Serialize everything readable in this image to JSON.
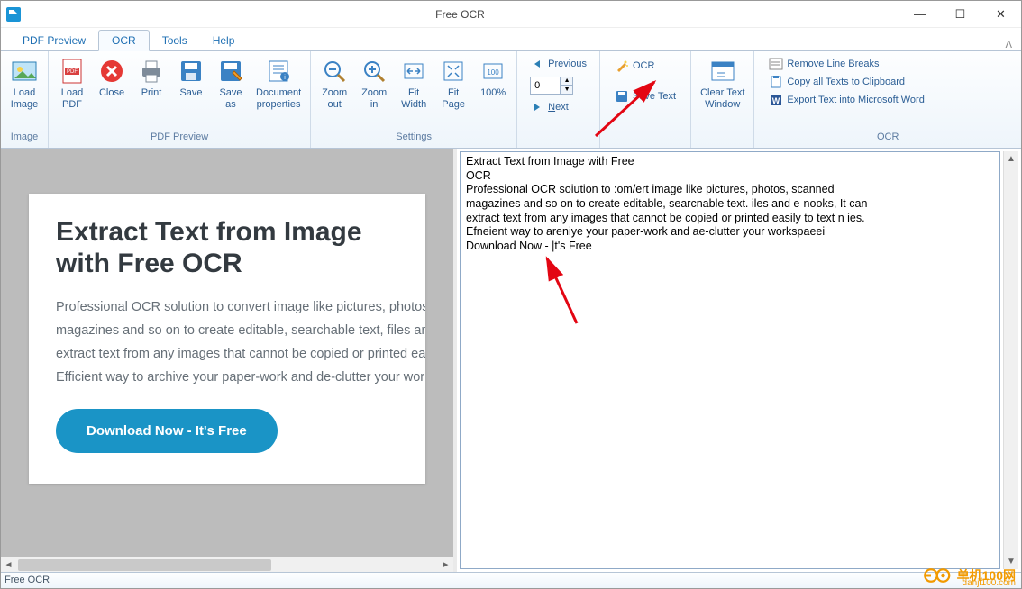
{
  "window": {
    "title": "Free OCR"
  },
  "tabs": {
    "items": [
      {
        "label": "PDF Preview"
      },
      {
        "label": "OCR"
      },
      {
        "label": "Tools"
      },
      {
        "label": "Help"
      }
    ],
    "active_index": 1
  },
  "ribbon": {
    "image": {
      "label": "Image",
      "load_image": "Load\nImage"
    },
    "pdf_preview": {
      "label": "PDF Preview",
      "load_pdf": "Load\nPDF",
      "close": "Close",
      "print": "Print",
      "save": "Save",
      "save_as": "Save\nas",
      "doc_props": "Document\nproperties"
    },
    "settings": {
      "label": "Settings",
      "zoom_out": "Zoom\nout",
      "zoom_in": "Zoom\nin",
      "fit_width": "Fit\nWidth",
      "fit_page": "Fit\nPage",
      "p100": "100%"
    },
    "nav": {
      "previous": "Previous",
      "next": "Next",
      "page_value": "0"
    },
    "ocr_group": {
      "ocr": "OCR",
      "save_text": "Save Text"
    },
    "clear": {
      "clear_text": "Clear Text\nWindow"
    },
    "text_ops": {
      "label": "OCR",
      "remove_breaks": "Remove Line Breaks",
      "copy_all": "Copy all Texts to Clipboard",
      "export_word": "Export Text into Microsoft Word"
    }
  },
  "preview_page": {
    "heading": "Extract Text from Image with Free OCR",
    "body_l1": "Professional OCR solution to convert image like pictures, photos, scanned",
    "body_l2": "magazines and so on to create editable, searchable text, files and e-books. It can",
    "body_l3": "extract text from any images that cannot be copied or printed easily to text files.",
    "body_l4": "Efficient way to archive your paper-work and de-clutter your workspace!",
    "button": "Download Now - It's Free"
  },
  "editor_text": "Extract Text from Image with Free\nOCR\nProfessional OCR soiution to :om/ert image like pictures, photos, scanned\nmagazines and so on to create editable, searcnable text. iles and e-nooks, It can\nextract text from any images that cannot be copied or printed easily to text n ies.\nEfneient way to areniye your paper-work and ae-clutter your workspaeei\nDownload Now - |t's Free",
  "statusbar": {
    "text": "Free OCR"
  },
  "watermark": {
    "brand": "单机100网",
    "url": "danji100.com"
  }
}
